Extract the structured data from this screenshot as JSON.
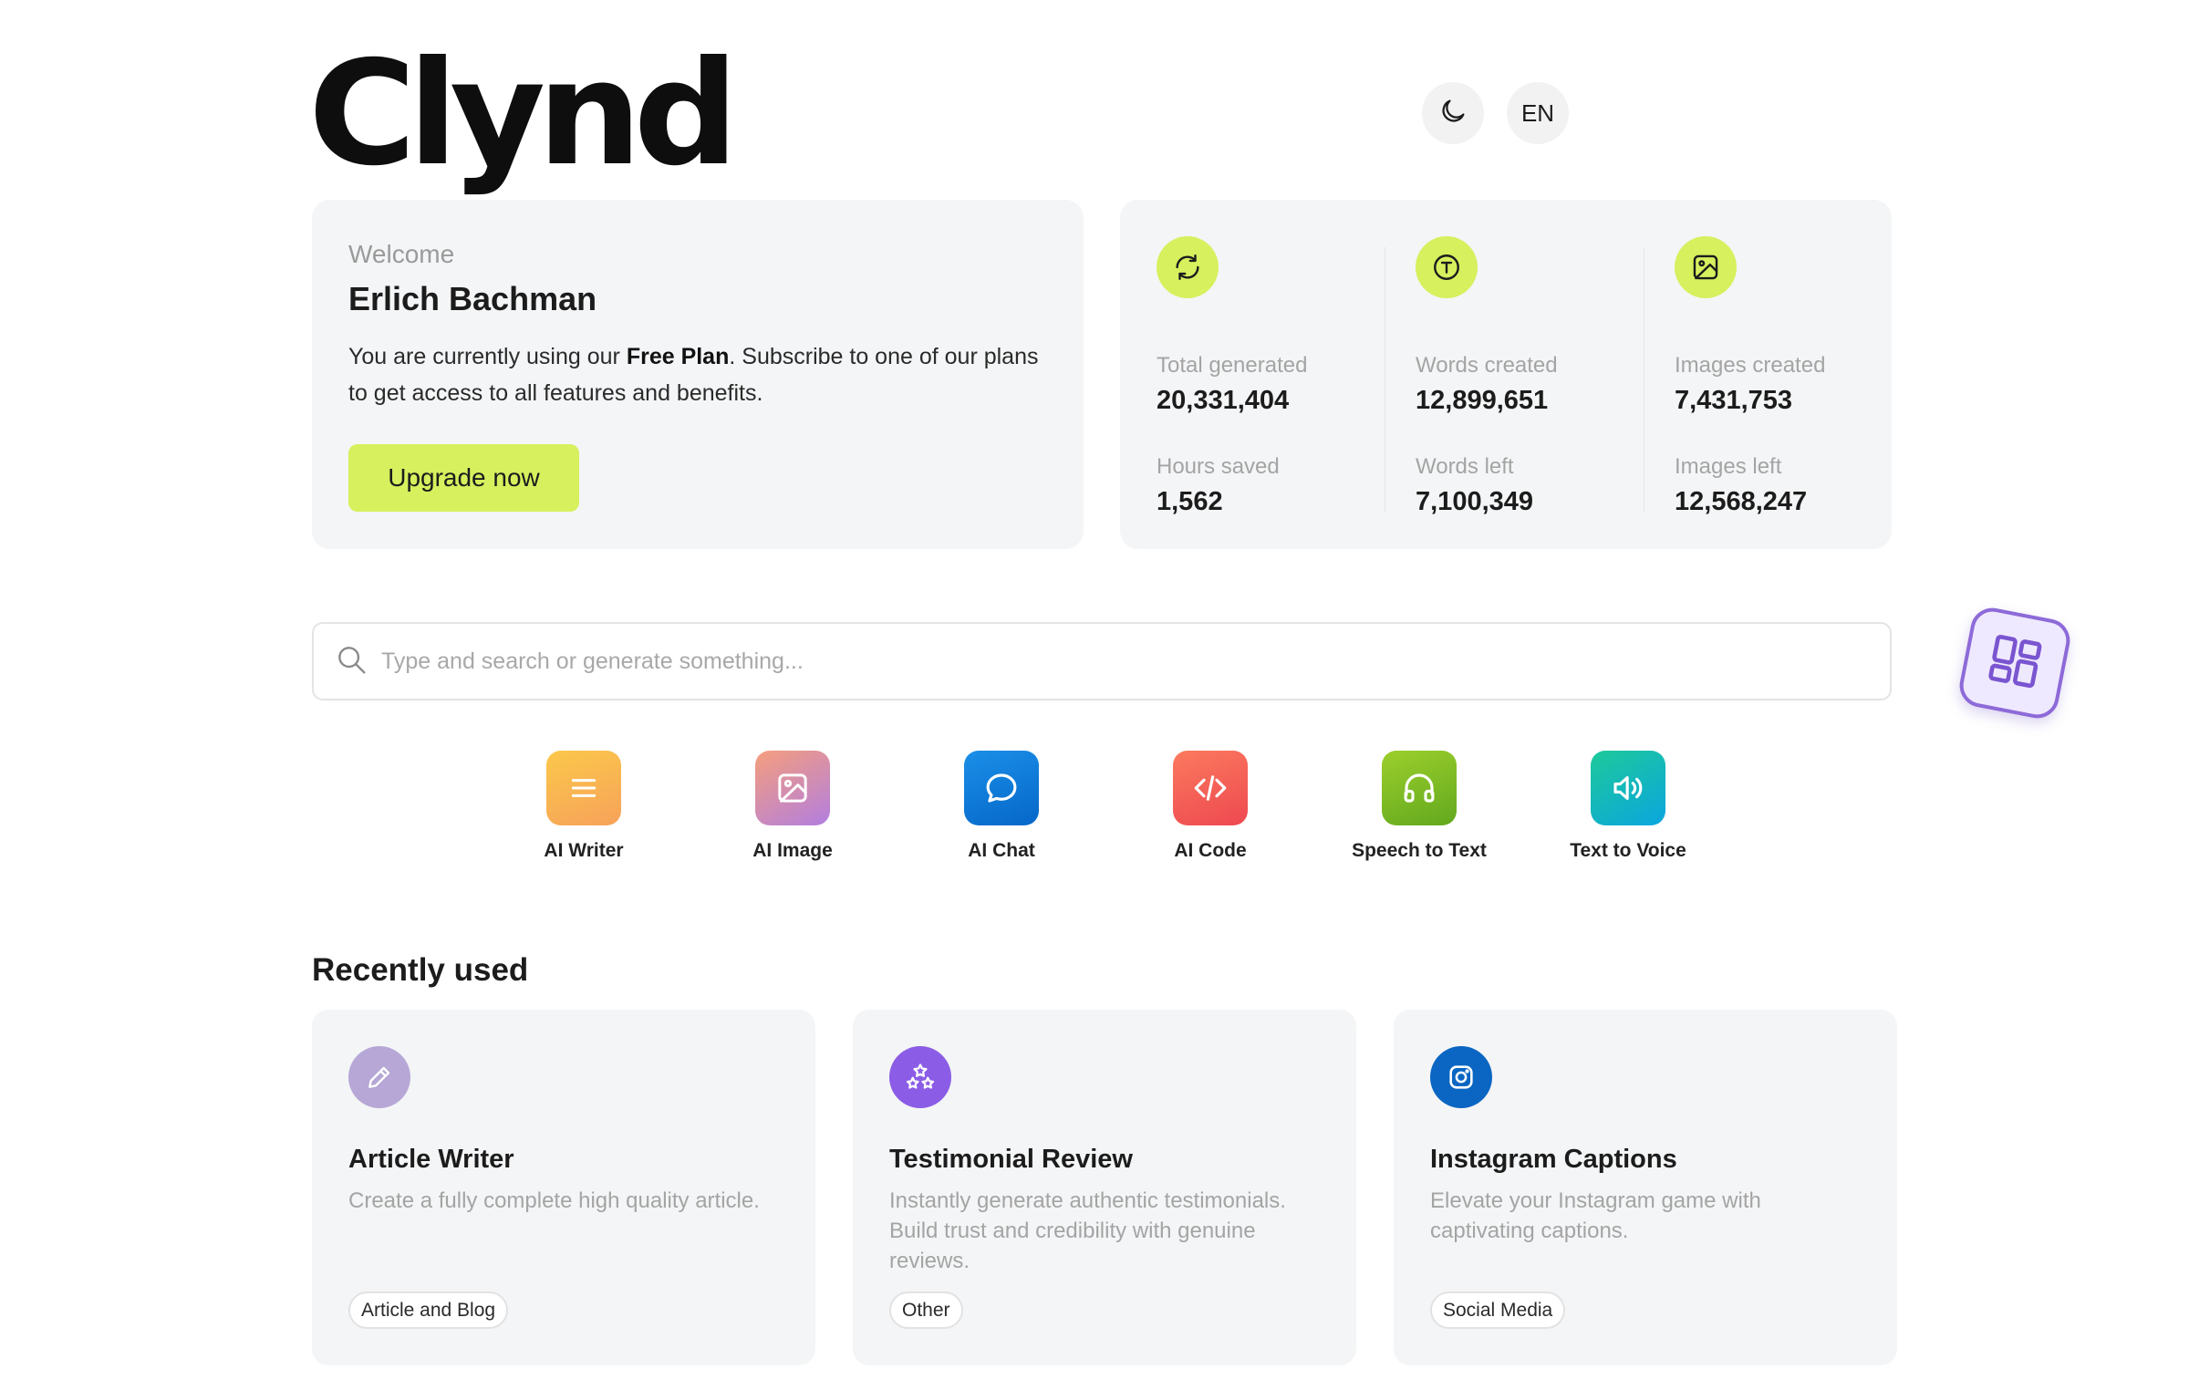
{
  "app": {
    "logo": "Clynd"
  },
  "header": {
    "language": "EN"
  },
  "welcome": {
    "greeting": "Welcome",
    "name": "Erlich Bachman",
    "text_before": "You are currently using our ",
    "plan": "Free Plan",
    "text_after": ". Subscribe to one of our plans to get access to all features and benefits.",
    "upgrade_label": "Upgrade now"
  },
  "stats": [
    {
      "icon": "refresh-icon",
      "label": "Total generated",
      "value": "20,331,404",
      "label2": "Hours saved",
      "value2": "1,562"
    },
    {
      "icon": "text-icon",
      "label": "Words created",
      "value": "12,899,651",
      "label2": "Words left",
      "value2": "7,100,349"
    },
    {
      "icon": "image-icon",
      "label": "Images created",
      "value": "7,431,753",
      "label2": "Images left",
      "value2": "12,568,247"
    }
  ],
  "search": {
    "placeholder": "Type and search or generate something..."
  },
  "tools": [
    {
      "label": "AI Writer",
      "icon": "lines-icon"
    },
    {
      "label": "AI Image",
      "icon": "image-icon"
    },
    {
      "label": "AI Chat",
      "icon": "chat-bubble-icon"
    },
    {
      "label": "AI Code",
      "icon": "code-icon"
    },
    {
      "label": "Speech to Text",
      "icon": "headphones-icon"
    },
    {
      "label": "Text to Voice",
      "icon": "speaker-icon"
    }
  ],
  "recent": {
    "title": "Recently used",
    "items": [
      {
        "title": "Article Writer",
        "description": "Create a fully complete high quality article.",
        "tag": "Article and Blog",
        "icon": "pencil-icon"
      },
      {
        "title": "Testimonial Review",
        "description": "Instantly generate authentic testimonials. Build trust and credibility with genuine reviews.",
        "tag": "Other",
        "icon": "stars-icon"
      },
      {
        "title": "Instagram Captions",
        "description": "Elevate your Instagram game with captivating captions.",
        "tag": "Social Media",
        "icon": "instagram-icon"
      }
    ]
  },
  "colors": {
    "accent": "#d6f05e",
    "card_bg": "#f4f5f6",
    "widget_purple": "#8d6ad8"
  }
}
